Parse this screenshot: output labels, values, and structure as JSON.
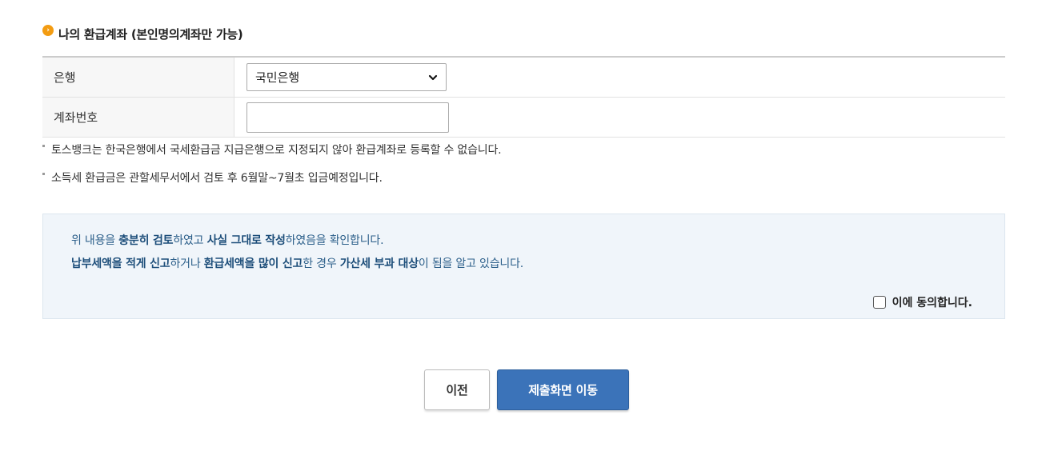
{
  "section": {
    "title": "나의 환급계좌 (본인명의계좌만 가능)",
    "icon": "orange-arrow-bullet-icon",
    "accent_color": "#f39c12"
  },
  "form": {
    "bank_label": "은행",
    "bank_selected": "국민은행",
    "account_label": "계좌번호",
    "account_value": ""
  },
  "notes": [
    "토스뱅크는 한국은행에서 국세환급금 지급은행으로 지정되지 않아 환급계좌로 등록할 수 없습니다.",
    "소득세 환급금은 관할세무서에서 검토 후 6월말~7월초 입금예정입니다."
  ],
  "agreement": {
    "line1": [
      {
        "text": "위 내용을 ",
        "bold": false
      },
      {
        "text": "충분히 검토",
        "bold": true
      },
      {
        "text": "하였고 ",
        "bold": false
      },
      {
        "text": "사실 그대로 작성",
        "bold": true
      },
      {
        "text": "하였음을 확인합니다.",
        "bold": false
      }
    ],
    "line2": [
      {
        "text": "납부세액을 적게 신고",
        "bold": true
      },
      {
        "text": "하거나 ",
        "bold": false
      },
      {
        "text": "환급세액을 많이 신고",
        "bold": true
      },
      {
        "text": "한 경우 ",
        "bold": false
      },
      {
        "text": "가산세 부과 대상",
        "bold": true
      },
      {
        "text": "이 됨을 알고 있습니다.",
        "bold": false
      }
    ],
    "checkbox_label": "이에 동의합니다.",
    "checked": false
  },
  "buttons": {
    "prev_label": "이전",
    "submit_label": "제출화면 이동",
    "submit_color": "#3b73b9"
  }
}
